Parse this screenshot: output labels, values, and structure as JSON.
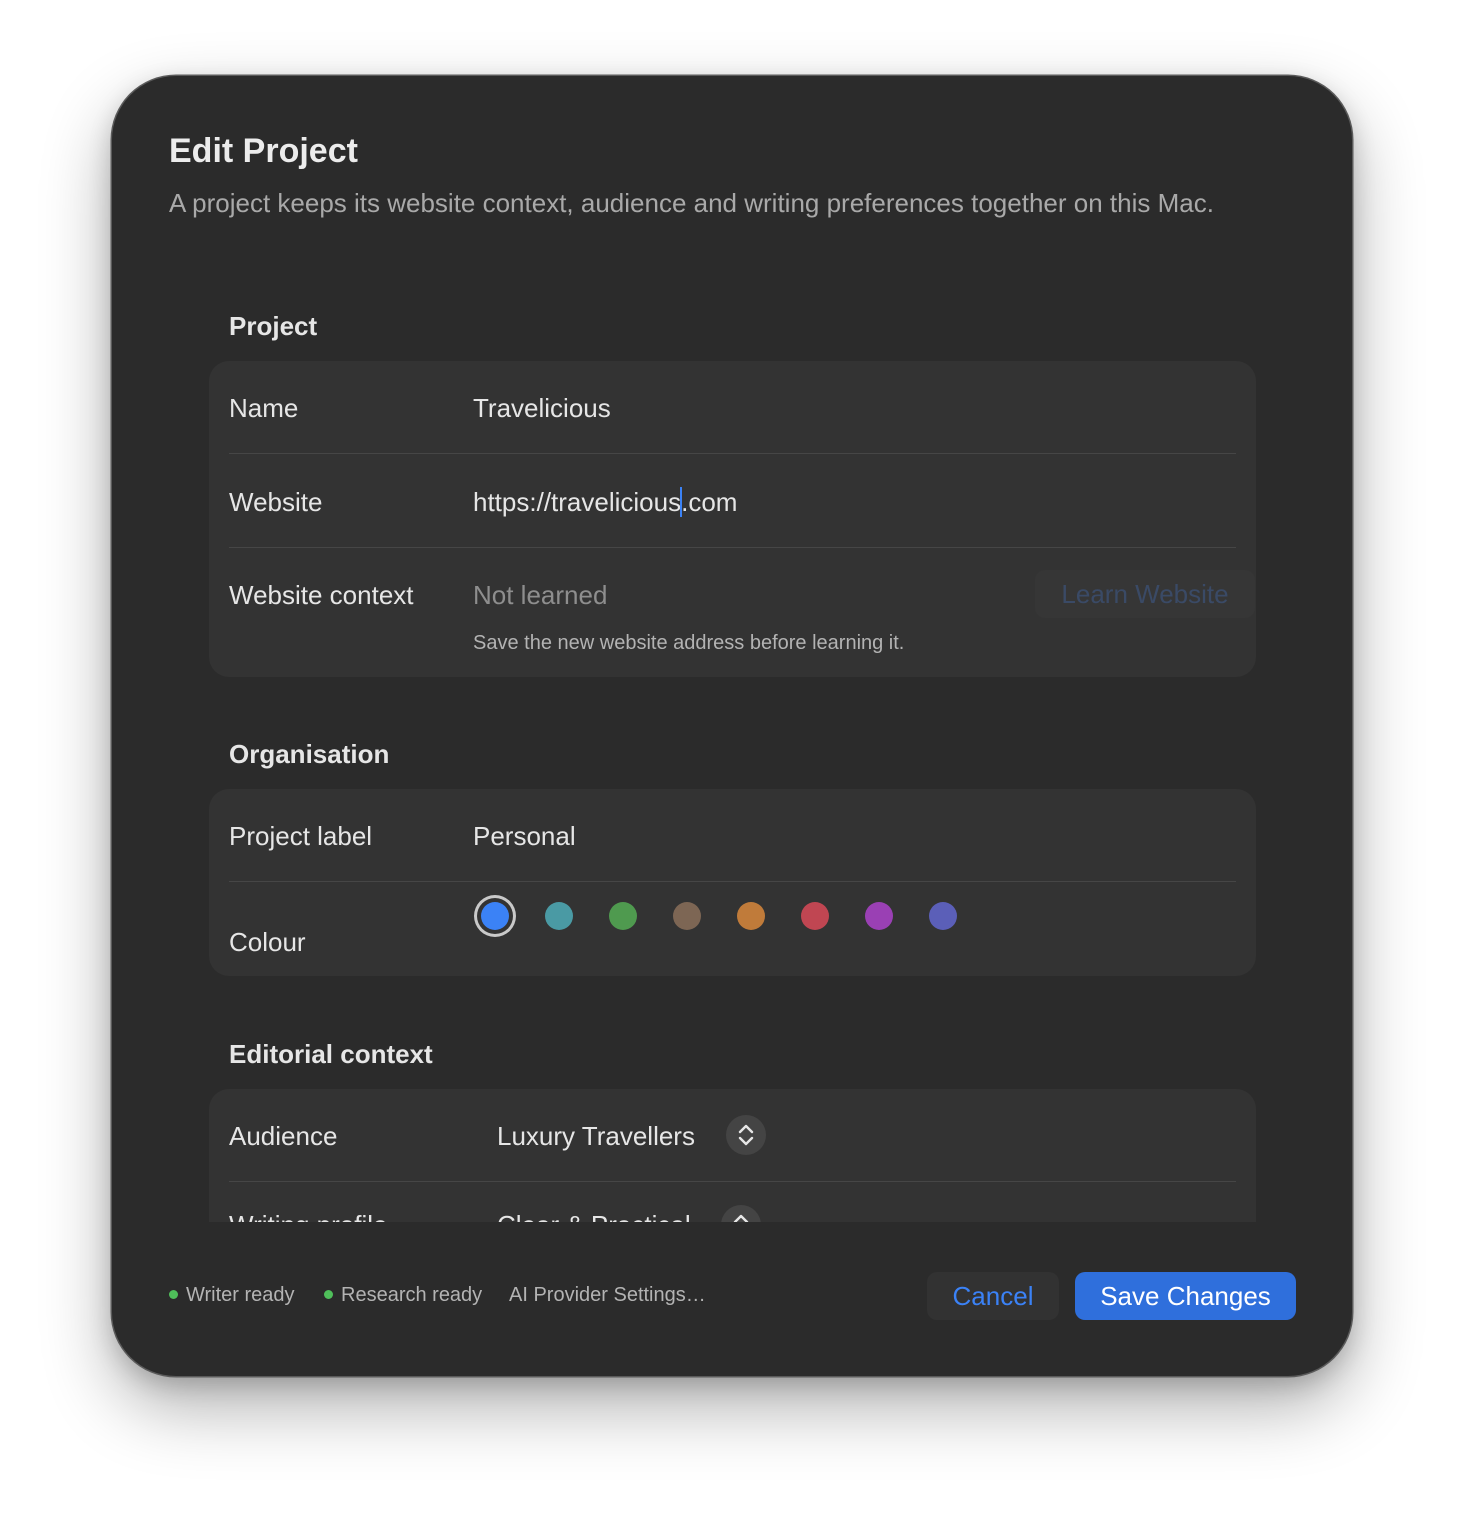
{
  "dialog": {
    "title": "Edit Project",
    "subtitle": "A project keeps its website context, audience and writing preferences together on this Mac."
  },
  "project": {
    "section_title": "Project",
    "name_label": "Name",
    "name_value": "Travelicious",
    "website_label": "Website",
    "website_value_before_caret": "https://travelicious",
    "website_value_after_caret": ".com",
    "context_label": "Website context",
    "context_value": "Not learned",
    "learn_button": "Learn Website",
    "context_hint": "Save the new website address before learning it."
  },
  "organisation": {
    "section_title": "Organisation",
    "label_label": "Project label",
    "label_value": "Personal",
    "colour_label": "Colour",
    "colours": [
      "#3b82f6",
      "#4a9aa4",
      "#4f9a4f",
      "#7d6654",
      "#c07b3a",
      "#c04652",
      "#9a40b4",
      "#5b5fb8"
    ],
    "selected_colour_index": 0
  },
  "editorial": {
    "section_title": "Editorial context",
    "audience_label": "Audience",
    "audience_value": "Luxury Travellers",
    "writing_profile_label": "Writing profile",
    "writing_profile_value": "Clear & Practical"
  },
  "footer": {
    "writer_status": "Writer ready",
    "research_status": "Research ready",
    "provider_link": "AI Provider Settings…",
    "cancel_button": "Cancel",
    "save_button": "Save Changes",
    "status_color": "#4fbf5a",
    "accent_color": "#2f6fdc"
  }
}
